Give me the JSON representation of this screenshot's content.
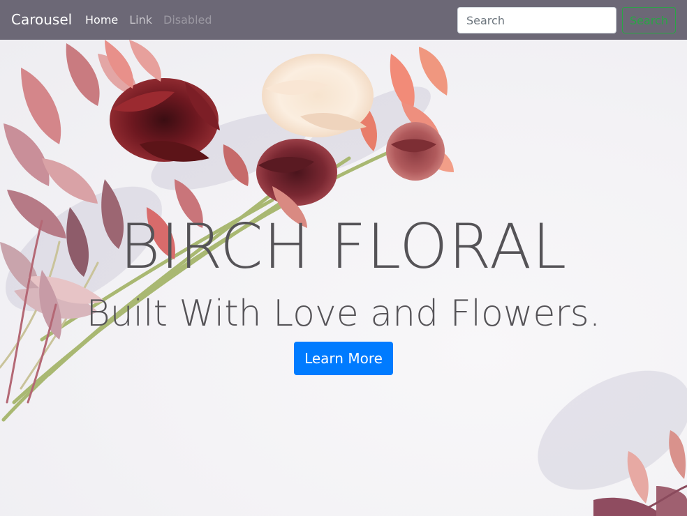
{
  "navbar": {
    "brand": "Carousel",
    "links": [
      {
        "label": "Home",
        "state": "active"
      },
      {
        "label": "Link",
        "state": "normal"
      },
      {
        "label": "Disabled",
        "state": "disabled"
      }
    ],
    "search": {
      "placeholder": "Search",
      "value": "",
      "button_label": "Search"
    }
  },
  "hero": {
    "title": "BIRCH FLORAL",
    "subtitle": "Built With Love and Flowers.",
    "cta_label": "Learn More"
  },
  "colors": {
    "navbar_bg": "#6c6876",
    "primary": "#007bff",
    "success": "#28a745",
    "hero_text": "#555357"
  }
}
